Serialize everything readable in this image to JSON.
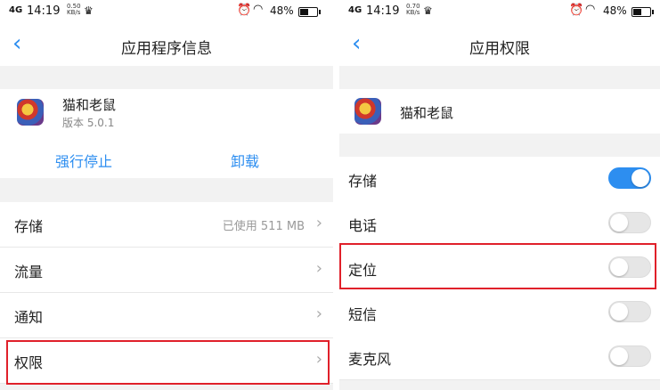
{
  "left": {
    "status": {
      "signal": "4G",
      "time": "14:19",
      "speed_top": "0.50",
      "speed_bottom": "KB/s",
      "battery": "48%"
    },
    "title": "应用程序信息",
    "app": {
      "name": "猫和老鼠",
      "version": "版本 5.0.1"
    },
    "actions": {
      "force_stop": "强行停止",
      "uninstall": "卸载"
    },
    "rows": [
      {
        "label": "存储",
        "value": "已使用 511 MB"
      },
      {
        "label": "流量",
        "value": ""
      },
      {
        "label": "通知",
        "value": ""
      },
      {
        "label": "权限",
        "value": ""
      }
    ]
  },
  "right": {
    "status": {
      "signal": "4G",
      "time": "14:19",
      "speed_top": "0.70",
      "speed_bottom": "KB/s",
      "battery": "48%"
    },
    "title": "应用权限",
    "app": {
      "name": "猫和老鼠"
    },
    "permissions": [
      {
        "label": "存储",
        "enabled": true
      },
      {
        "label": "电话",
        "enabled": false
      },
      {
        "label": "定位",
        "enabled": false
      },
      {
        "label": "短信",
        "enabled": false
      },
      {
        "label": "麦克风",
        "enabled": false
      }
    ]
  },
  "colors": {
    "accent": "#2d8ef0",
    "highlight": "#e0202a"
  }
}
